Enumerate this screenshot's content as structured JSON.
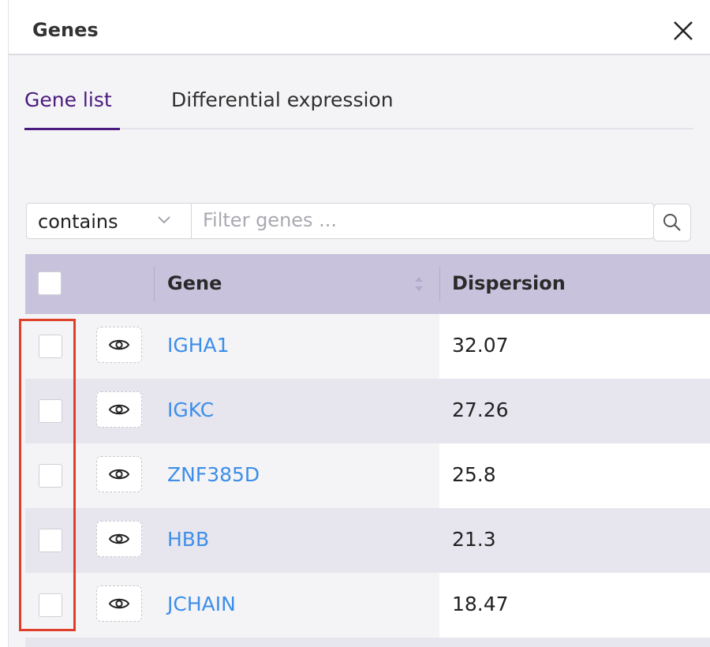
{
  "dialog": {
    "title": "Genes"
  },
  "tabs": [
    {
      "label": "Gene list",
      "active": true
    },
    {
      "label": "Differential expression",
      "active": false
    }
  ],
  "filter": {
    "mode": "contains",
    "placeholder": "Filter genes ..."
  },
  "table": {
    "columns": [
      "Gene",
      "Dispersion"
    ],
    "rows": [
      {
        "gene": "IGHA1",
        "dispersion": "32.07"
      },
      {
        "gene": "IGKC",
        "dispersion": "27.26"
      },
      {
        "gene": "ZNF385D",
        "dispersion": "25.8"
      },
      {
        "gene": "HBB",
        "dispersion": "21.3"
      },
      {
        "gene": "JCHAIN",
        "dispersion": "18.47"
      }
    ]
  },
  "icons": {
    "close": "close-icon",
    "dropdown": "chevron-down-icon",
    "search": "search-icon",
    "view": "eye-icon",
    "sort": "sort-icon"
  },
  "colors": {
    "accent": "#4a1a7d",
    "link": "#3d8ee8",
    "header_bg": "#c9c2dd",
    "highlight": "#e0402b"
  }
}
